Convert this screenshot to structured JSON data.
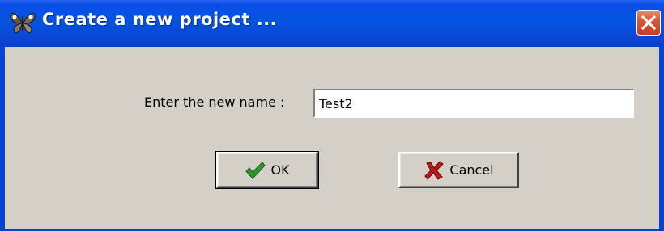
{
  "window": {
    "title": "Create a new project ...",
    "icons": {
      "app": "butterfly-icon",
      "close": "close-icon"
    }
  },
  "form": {
    "name_label": "Enter the new name :",
    "name_value": "Test2"
  },
  "buttons": {
    "ok": {
      "label": "OK",
      "icon": "checkmark-icon"
    },
    "cancel": {
      "label": "Cancel",
      "icon": "x-mark-icon"
    }
  },
  "colors": {
    "titlebar": "#0454e0",
    "dialog_face": "#d4d0c8",
    "close_button": "#d65a36",
    "ok_icon": "#2e9a2e",
    "cancel_icon": "#c01818"
  }
}
